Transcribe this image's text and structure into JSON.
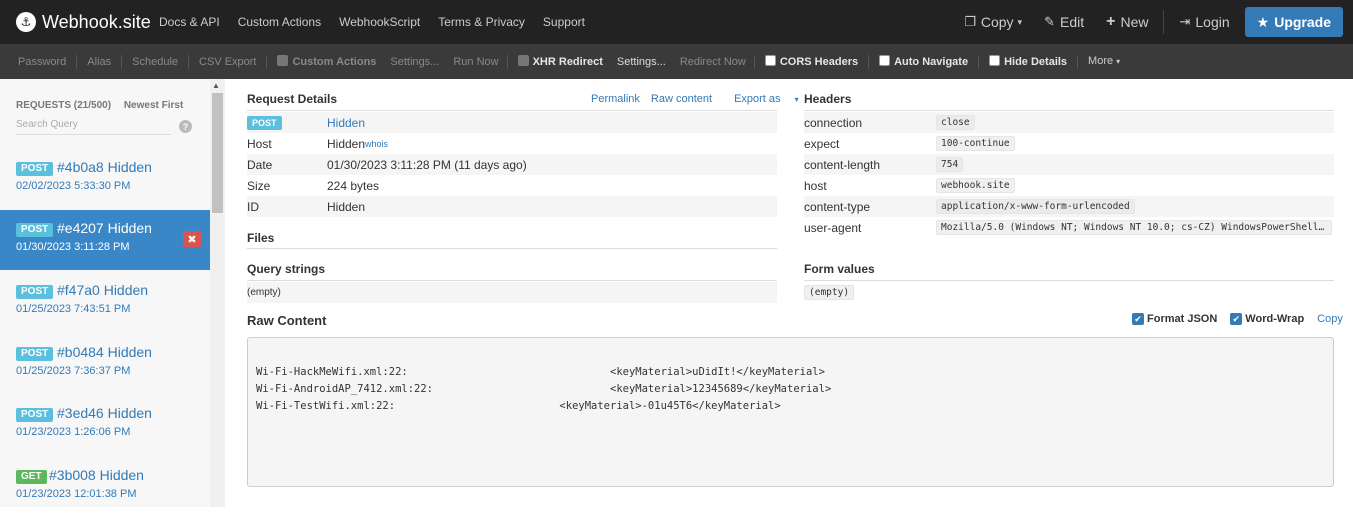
{
  "navbar": {
    "brand": "Webhook.site",
    "links": [
      "Docs & API",
      "Custom Actions",
      "WebhookScript",
      "Terms & Privacy",
      "Support"
    ],
    "copy": "Copy",
    "edit": "Edit",
    "new": "New",
    "login": "Login",
    "upgrade": "Upgrade"
  },
  "toolbar": {
    "password": "Password",
    "alias": "Alias",
    "schedule": "Schedule",
    "csv_export": "CSV Export",
    "custom_actions": "Custom Actions",
    "settings1": "Settings...",
    "run_now": "Run Now",
    "xhr_redirect": "XHR Redirect",
    "settings2": "Settings...",
    "redirect_now": "Redirect Now",
    "cors_headers": "CORS Headers",
    "auto_navigate": "Auto Navigate",
    "hide_details": "Hide Details",
    "more": "More"
  },
  "sidebar": {
    "requests_label": "REQUESTS (21/500)",
    "newest_first": "Newest First",
    "search_placeholder": "Search Query",
    "help": "?",
    "requests": [
      {
        "method": "POST",
        "id": "#4b0a8 Hidden",
        "time": "02/02/2023 5:33:30 PM"
      },
      {
        "method": "POST",
        "id": "#e4207 Hidden",
        "time": "01/30/2023 3:11:28 PM"
      },
      {
        "method": "POST",
        "id": "#f47a0 Hidden",
        "time": "01/25/2023 7:43:51 PM"
      },
      {
        "method": "POST",
        "id": "#b0484 Hidden",
        "time": "01/25/2023 7:36:37 PM"
      },
      {
        "method": "POST",
        "id": "#3ed46 Hidden",
        "time": "01/23/2023 1:26:06 PM"
      },
      {
        "method": "GET",
        "id": "#3b008 Hidden",
        "time": "01/23/2023 12:01:38 PM"
      }
    ]
  },
  "request_details": {
    "title": "Request Details",
    "permalink": "Permalink",
    "raw_content_link": "Raw content",
    "export_as": "Export as",
    "method": "POST",
    "url": "Hidden",
    "host_label": "Host",
    "host_value": "Hidden",
    "whois": "whois",
    "date_label": "Date",
    "date_value": "01/30/2023 3:11:28 PM (11 days ago)",
    "size_label": "Size",
    "size_value": "224 bytes",
    "id_label": "ID",
    "id_value": "Hidden"
  },
  "files": {
    "title": "Files"
  },
  "query_strings": {
    "title": "Query strings",
    "value": "(empty)"
  },
  "headers": {
    "title": "Headers",
    "items": [
      {
        "key": "connection",
        "value": "close"
      },
      {
        "key": "expect",
        "value": "100-continue"
      },
      {
        "key": "content-length",
        "value": "754"
      },
      {
        "key": "host",
        "value": "webhook.site"
      },
      {
        "key": "content-type",
        "value": "application/x-www-form-urlencoded"
      },
      {
        "key": "user-agent",
        "value": "Mozilla/5.0 (Windows NT; Windows NT 10.0; cs-CZ) WindowsPowerShell/..."
      }
    ]
  },
  "form_values": {
    "title": "Form values",
    "value": "(empty)"
  },
  "raw_content": {
    "title": "Raw Content",
    "format_json": "Format JSON",
    "word_wrap": "Word-Wrap",
    "copy": "Copy",
    "body": "Wi-Fi-HackMeWifi.xml:22:                                <keyMaterial>uDidIt!</keyMaterial>\nWi-Fi-AndroidAP_7412.xml:22:                            <keyMaterial>12345689</keyMaterial>\nWi-Fi-TestWifi.xml:22:                          <keyMaterial>-01u45T6</keyMaterial>"
  }
}
